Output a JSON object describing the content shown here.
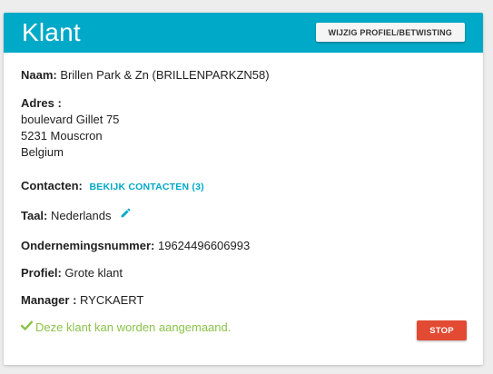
{
  "header": {
    "title": "Klant",
    "edit_profile_button": "WIJZIG PROFIEL/BETWISTING"
  },
  "customer": {
    "name_label": "Naam:",
    "name_value": "Brillen Park & Zn (BRILLENPARKZN58)",
    "address_label": "Adres :",
    "address_line1": "boulevard Gillet 75",
    "address_line2": "5231 Mouscron",
    "address_line3": "Belgium",
    "contacts_label": "Contacten:",
    "contacts_link": "BEKIJK CONTACTEN (3)",
    "language_label": "Taal:",
    "language_value": "Nederlands",
    "company_number_label": "Ondernemingsnummer:",
    "company_number_value": "19624496606993",
    "profile_label": "Profiel:",
    "profile_value": "Grote klant",
    "manager_label": "Manager :",
    "manager_value": "RYCKAERT"
  },
  "status": {
    "message": "Deze klant kan worden aangemaand.",
    "icon": "check-icon",
    "color": "#8bc34a"
  },
  "actions": {
    "stop_button": "STOP"
  },
  "colors": {
    "accent": "#00a9c7",
    "stop": "#e24a33"
  }
}
